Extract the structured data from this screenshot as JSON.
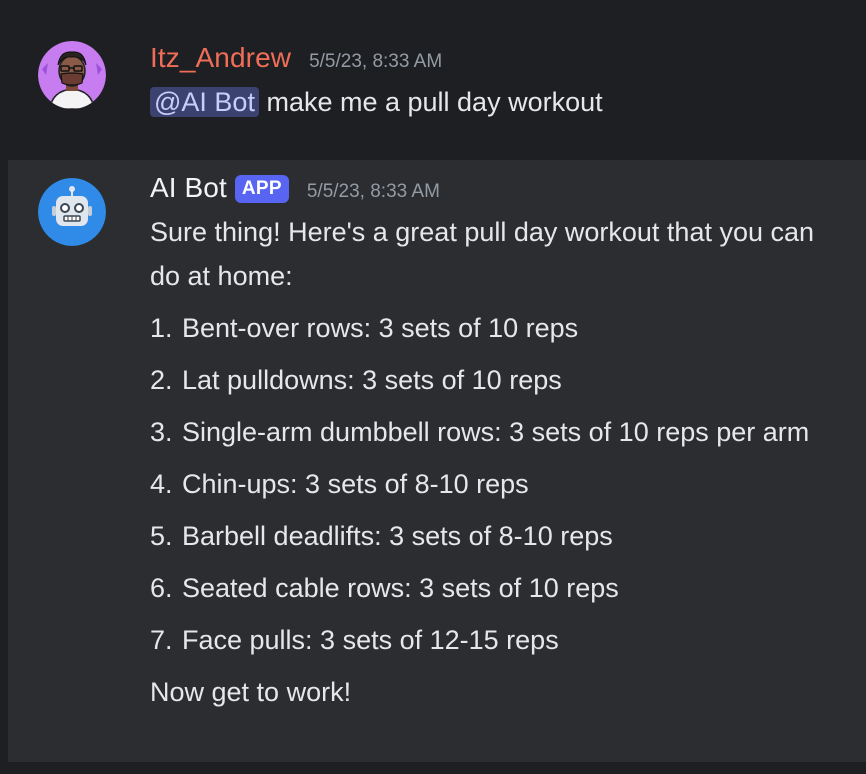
{
  "user_message": {
    "username": "Itz_Andrew",
    "timestamp": "5/5/23, 8:33 AM",
    "mention": "@AI Bot",
    "text": " make me a pull day workout",
    "avatar_icon": "cartoon-avatar-icon"
  },
  "bot_message": {
    "username": "AI Bot",
    "badge": "APP",
    "timestamp": "5/5/23, 8:33 AM",
    "intro": "Sure thing! Here's a great pull day workout that you can do at home:",
    "items": [
      {
        "num": "1.",
        "text": "Bent-over rows: 3 sets of 10 reps"
      },
      {
        "num": "2.",
        "text": "Lat pulldowns: 3 sets of 10 reps"
      },
      {
        "num": "3.",
        "text": "Single-arm dumbbell rows: 3 sets of 10 reps per arm"
      },
      {
        "num": "4.",
        "text": "Chin-ups: 3 sets of 8-10 reps"
      },
      {
        "num": "5.",
        "text": "Barbell deadlifts: 3 sets of 8-10 reps"
      },
      {
        "num": "6.",
        "text": "Seated cable rows: 3 sets of 10 reps"
      },
      {
        "num": "7.",
        "text": "Face pulls: 3 sets of 12-15 reps"
      }
    ],
    "outro": "Now get to work!",
    "avatar_icon": "robot-icon"
  },
  "colors": {
    "background": "#1e1f22",
    "bot_message_bg": "#2b2d31",
    "user_name": "#f06e58",
    "badge": "#5865f2",
    "mention_bg": "#3c4270",
    "avatar_user_bg": "#c77df0",
    "avatar_bot_bg": "#2f8ae8"
  }
}
